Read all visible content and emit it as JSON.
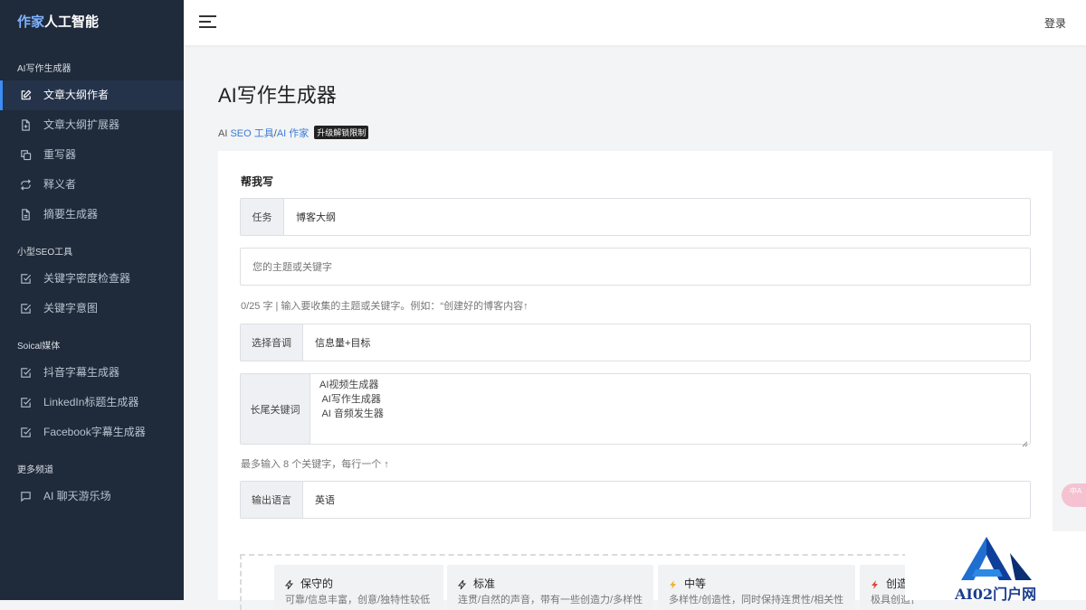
{
  "brand": {
    "part1": "作家",
    "part2": "人工智能"
  },
  "sidebar": {
    "sections": [
      {
        "title": "AI写作生成器",
        "items": [
          {
            "label": "文章大纲作者",
            "icon": "edit-icon",
            "active": true
          },
          {
            "label": "文章大纲扩展器",
            "icon": "file-plus-icon"
          },
          {
            "label": "重写器",
            "icon": "copy-icon"
          },
          {
            "label": "释义者",
            "icon": "repeat-icon"
          },
          {
            "label": "摘要生成器",
            "icon": "file-text-icon"
          }
        ]
      },
      {
        "title": "小型SEO工具",
        "items": [
          {
            "label": "关键字密度检查器",
            "icon": "checkbox-icon"
          },
          {
            "label": "关键字意图",
            "icon": "checkbox-icon"
          }
        ]
      },
      {
        "title": "Soical媒体",
        "items": [
          {
            "label": "抖音字幕生成器",
            "icon": "checkbox-icon"
          },
          {
            "label": "LinkedIn标题生成器",
            "icon": "checkbox-icon"
          },
          {
            "label": "Facebook字幕生成器",
            "icon": "checkbox-icon"
          }
        ]
      },
      {
        "title": "更多频道",
        "items": [
          {
            "label": "AI 聊天游乐场",
            "icon": "message-icon"
          }
        ]
      }
    ]
  },
  "header": {
    "login": "登录"
  },
  "main": {
    "title": "AI写作生成器",
    "breadcrumb": {
      "prefix": "AI ",
      "link1": "SEO 工具",
      "sep": "/",
      "link2": "AI 作家",
      "badge": "升级解锁限制"
    },
    "form": {
      "heading": "帮我写",
      "task_label": "任务",
      "task_value": "博客大纲",
      "topic_placeholder": "您的主题或关键字",
      "topic_hint": "0/25 字 | 输入要收集的主题或关键字。例如：“创建好的博客内容↑",
      "tone_label": "选择音调",
      "tone_value": "信息量+目标",
      "keywords_label": "长尾关键词",
      "keywords": [
        "AI视频生成器",
        " AI写作生成器",
        " AI 音频发生器"
      ],
      "keywords_hint": "最多输入 8 个关键字，每行一个 ↑",
      "lang_label": "输出语言",
      "lang_value": "英语"
    },
    "tones": [
      {
        "name": "保守的",
        "desc": "可靠/信息丰富，创意/独特性较低",
        "color": "#333333"
      },
      {
        "name": "标准",
        "desc": "连贯/自然的声音，带有一些创造力/多样性",
        "color": "#333333"
      },
      {
        "name": "中等",
        "desc": "多样性/创造性，同时保持连贯性/相关性",
        "color": "#f0b429"
      },
      {
        "name": "创造",
        "desc": "极具创造性",
        "color": "#e0453a"
      }
    ]
  },
  "fab": {
    "text": "中A"
  },
  "watermark": {
    "text": "AI02门户网",
    "color": "#1b3d8f"
  }
}
